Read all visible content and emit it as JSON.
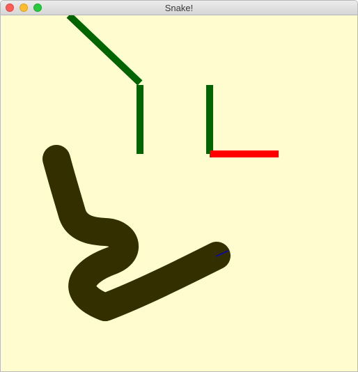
{
  "window": {
    "title": "Snake!"
  },
  "game": {
    "background_color": "#fffdd0",
    "wall_color": "#006400",
    "food_color": "#ff0000",
    "snake_color": "#332f00",
    "direction_indicator_color": "#0000cc"
  }
}
